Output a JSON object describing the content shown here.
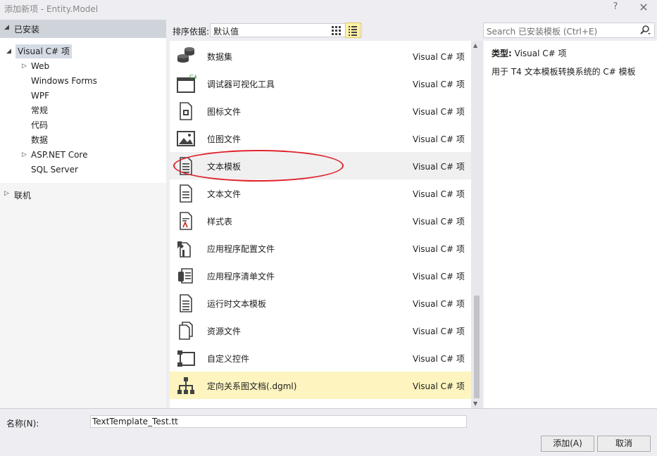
{
  "window": {
    "title": "添加新项 - Entity.Model",
    "help": "?",
    "close": "✕"
  },
  "left": {
    "installed_label": "已安装",
    "tree": [
      {
        "label": "Visual C# 项",
        "expanded": true,
        "selected": true
      },
      {
        "label": "Web",
        "has_children": true
      },
      {
        "label": "Windows Forms"
      },
      {
        "label": "WPF"
      },
      {
        "label": "常规"
      },
      {
        "label": "代码"
      },
      {
        "label": "数据"
      },
      {
        "label": "ASP.NET Core",
        "has_children": true
      },
      {
        "label": "SQL Server"
      }
    ],
    "online_label": "联机"
  },
  "toolbar": {
    "sort_label": "排序依据:",
    "sort_value": "默认值"
  },
  "search": {
    "placeholder": "Search 已安装模板 (Ctrl+E)"
  },
  "items": [
    {
      "name": "数据集",
      "type": "Visual C# 项",
      "icon": "dataset-icon"
    },
    {
      "name": "调试器可视化工具",
      "type": "Visual C# 项",
      "icon": "debugger-visualizer-icon"
    },
    {
      "name": "图标文件",
      "type": "Visual C# 项",
      "icon": "icon-file-icon"
    },
    {
      "name": "位图文件",
      "type": "Visual C# 项",
      "icon": "bitmap-icon"
    },
    {
      "name": "文本模板",
      "type": "Visual C# 项",
      "icon": "text-template-icon",
      "state": "hover",
      "circled": true
    },
    {
      "name": "文本文件",
      "type": "Visual C# 项",
      "icon": "text-file-icon"
    },
    {
      "name": "样式表",
      "type": "Visual C# 项",
      "icon": "stylesheet-icon"
    },
    {
      "name": "应用程序配置文件",
      "type": "Visual C# 项",
      "icon": "app-config-icon"
    },
    {
      "name": "应用程序清单文件",
      "type": "Visual C# 项",
      "icon": "app-manifest-icon"
    },
    {
      "name": "运行时文本模板",
      "type": "Visual C# 项",
      "icon": "runtime-text-template-icon"
    },
    {
      "name": "资源文件",
      "type": "Visual C# 项",
      "icon": "resource-file-icon"
    },
    {
      "name": "自定义控件",
      "type": "Visual C# 项",
      "icon": "custom-control-icon"
    },
    {
      "name": "定向关系图文档(.dgml)",
      "type": "Visual C# 项",
      "icon": "dgml-icon",
      "state": "selected"
    }
  ],
  "details": {
    "type_label": "类型:",
    "type_value": "Visual C# 项",
    "description": "用于 T4 文本模板转换系统的 C# 模板"
  },
  "bottom": {
    "name_label": "名称(N):",
    "name_value": "TextTemplate_Test.tt",
    "add_label": "添加(A)",
    "cancel_label": "取消"
  },
  "colors": {
    "selected_row": "#fdf4bf",
    "hover_row": "#f0f0f0",
    "annotation": "#e0212a"
  }
}
